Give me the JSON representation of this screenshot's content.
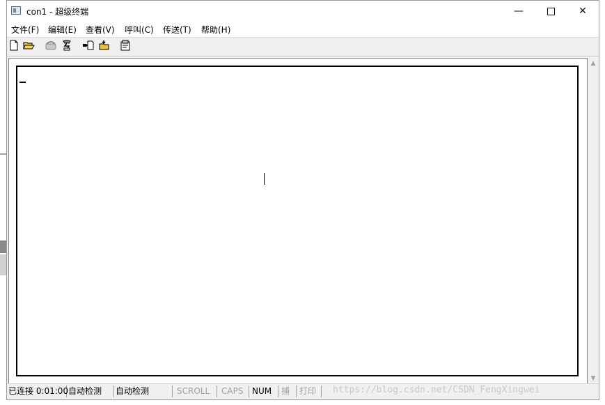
{
  "window": {
    "title": "con1 - 超级终端",
    "controls": {
      "minimize": "—",
      "close": "✕"
    }
  },
  "menu": [
    {
      "label": "文件(F)"
    },
    {
      "label": "编辑(E)"
    },
    {
      "label": "查看(V)"
    },
    {
      "label": "呼叫(C)"
    },
    {
      "label": "传送(T)"
    },
    {
      "label": "帮助(H)"
    }
  ],
  "toolbar": {
    "icons": [
      "new-file-icon",
      "open-folder-icon",
      "call-icon",
      "disconnect-icon",
      "send-file-icon",
      "receive-file-icon",
      "properties-icon"
    ]
  },
  "statusbar": {
    "connection": "已连接 0:01:00",
    "detect1": "自动检测",
    "detect2": "自动检测",
    "scroll": "SCROLL",
    "caps": "CAPS",
    "num": "NUM",
    "capture": "捕",
    "print": "打印"
  },
  "watermark": "https://blog.csdn.net/CSDN_FengXingwei"
}
